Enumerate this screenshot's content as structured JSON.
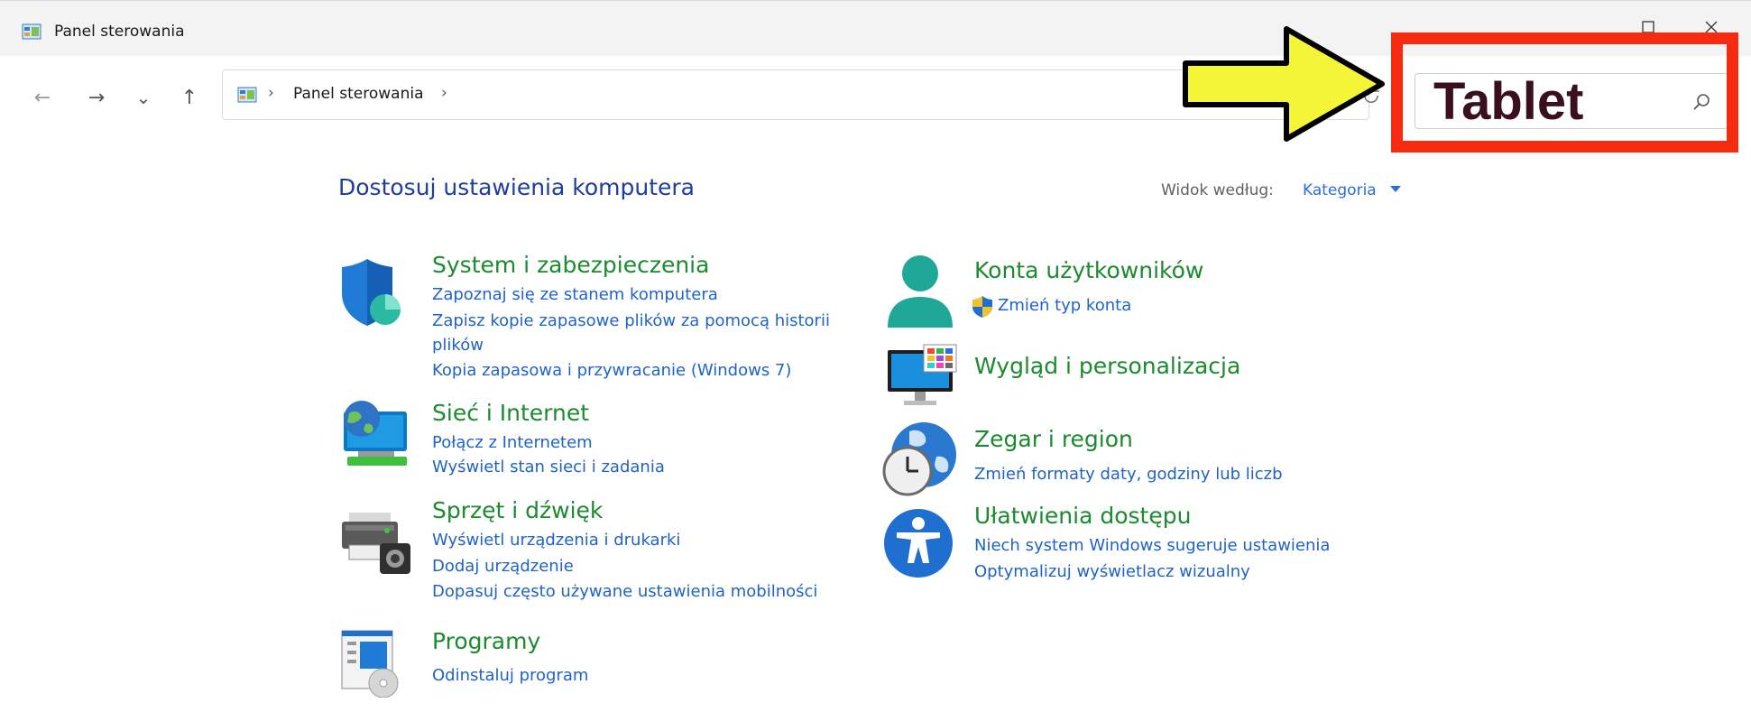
{
  "window": {
    "title": "Panel sterowania"
  },
  "nav": {
    "back": "←",
    "forward": "→",
    "recent": "⌄",
    "up": "↑"
  },
  "address": {
    "separator1": "›",
    "path": "Panel sterowania",
    "separator2": "›"
  },
  "search": {
    "value": "Tablet"
  },
  "main": {
    "heading": "Dostosuj ustawienia komputera",
    "view_label": "Widok według:",
    "view_value": "Kategoria"
  },
  "categories": {
    "system": {
      "title": "System i zabezpieczenia",
      "links": [
        "Zapoznaj się ze stanem komputera",
        "Zapisz kopie zapasowe plików za pomocą historii",
        "plików",
        "Kopia zapasowa i przywracanie (Windows 7)"
      ]
    },
    "network": {
      "title": "Sieć i Internet",
      "links": [
        "Połącz z Internetem",
        "Wyświetl stan sieci i zadania"
      ]
    },
    "hardware": {
      "title": "Sprzęt i dźwięk",
      "links": [
        "Wyświetl urządzenia i drukarki",
        "Dodaj urządzenie",
        "Dopasuj często używane ustawienia mobilności"
      ]
    },
    "programs": {
      "title": "Programy",
      "links": [
        "Odinstaluj program"
      ]
    },
    "accounts": {
      "title": "Konta użytkowników",
      "links": [
        "Zmień typ konta"
      ]
    },
    "appearance": {
      "title": "Wygląd i personalizacja"
    },
    "clock": {
      "title": "Zegar i region",
      "links": [
        "Zmień formaty daty, godziny lub liczb"
      ]
    },
    "ease": {
      "title": "Ułatwienia dostępu",
      "links": [
        "Niech system Windows sugeruje ustawienia",
        "Optymalizuj wyświetlacz wizualny"
      ]
    }
  },
  "colors": {
    "highlight": "#f62a0e",
    "arrow": "#f4f536",
    "title_green": "#1c8a2e",
    "link_blue": "#1f63c9",
    "heading_blue": "#1e3d9e"
  }
}
